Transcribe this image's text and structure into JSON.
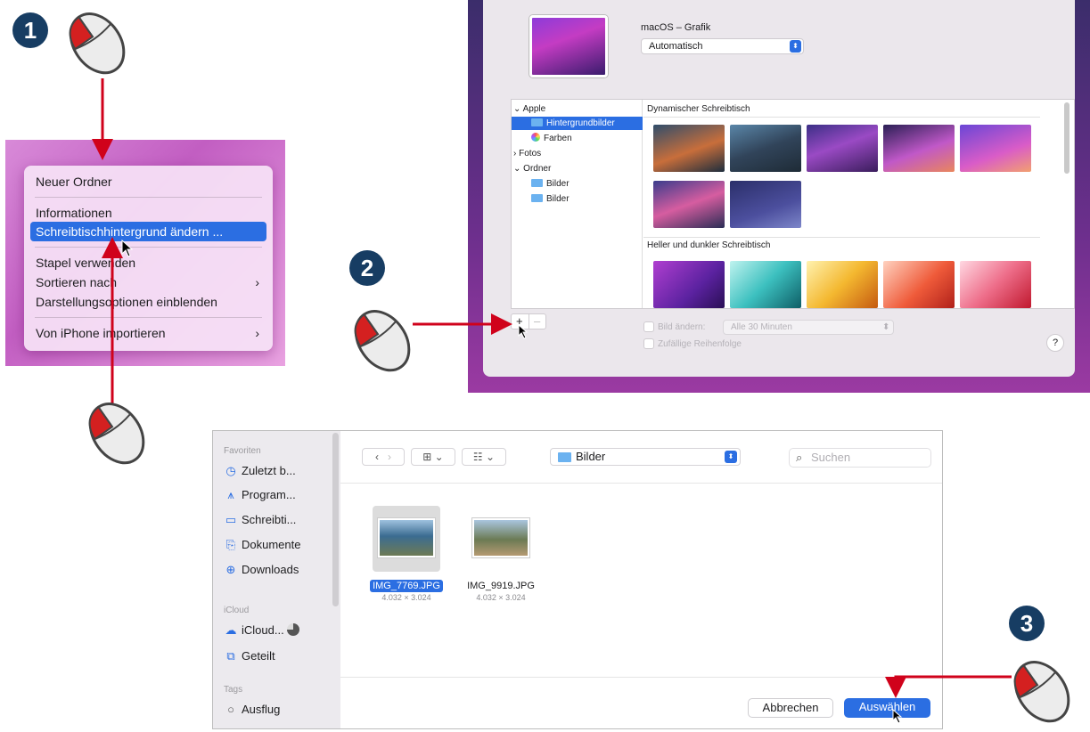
{
  "steps": [
    "1",
    "2",
    "3"
  ],
  "context_menu": {
    "items": [
      {
        "label": "Neuer Ordner"
      },
      {
        "label": "Informationen"
      },
      {
        "label": "Schreibtischhintergrund ändern ..."
      },
      {
        "label": "Stapel verwenden"
      },
      {
        "label": "Sortieren nach"
      },
      {
        "label": "Darstellungsoptionen einblenden"
      },
      {
        "label": "Von iPhone importieren"
      }
    ],
    "selected_index": 2,
    "submenu_chevron": "›"
  },
  "wallpaper_prefs": {
    "current_name": "macOS – Grafik",
    "mode_value": "Automatisch",
    "sources": [
      {
        "label": "Apple",
        "chevron": "⌄"
      },
      {
        "label": "Hintergrundbilder"
      },
      {
        "label": "Farben"
      },
      {
        "label": "Fotos",
        "chevron": "›"
      },
      {
        "label": "Ordner",
        "chevron": "⌄"
      },
      {
        "label": "Bilder"
      },
      {
        "label": "Bilder"
      }
    ],
    "sections": [
      "Dynamischer Schreibtisch",
      "Heller und dunkler Schreibtisch"
    ],
    "add_symbol": "+",
    "remove_symbol": "–",
    "change_picture_label": "Bild ändern:",
    "interval_value": "Alle 30 Minuten",
    "random_order_label": "Zufällige Reihenfolge",
    "help_symbol": "?"
  },
  "file_dialog": {
    "sidebar": {
      "favorites_header": "Favoriten",
      "favorites": [
        "Zuletzt b...",
        "Program...",
        "Schreibti...",
        "Dokumente",
        "Downloads"
      ],
      "icloud_header": "iCloud",
      "icloud": [
        "iCloud...",
        "Geteilt"
      ],
      "tags_header": "Tags",
      "tags": [
        "Ausflug"
      ]
    },
    "location": "Bilder",
    "search_placeholder": "Suchen",
    "files": [
      {
        "name": "IMG_7769.JPG",
        "size": "4.032 × 3.024",
        "selected": true
      },
      {
        "name": "IMG_9919.JPG",
        "size": "4.032 × 3.024",
        "selected": false
      }
    ],
    "cancel_label": "Abbrechen",
    "choose_label": "Auswählen"
  },
  "colors": {
    "accent": "#2b6ee2",
    "arrow": "#d0021b",
    "badge": "#173d63"
  }
}
